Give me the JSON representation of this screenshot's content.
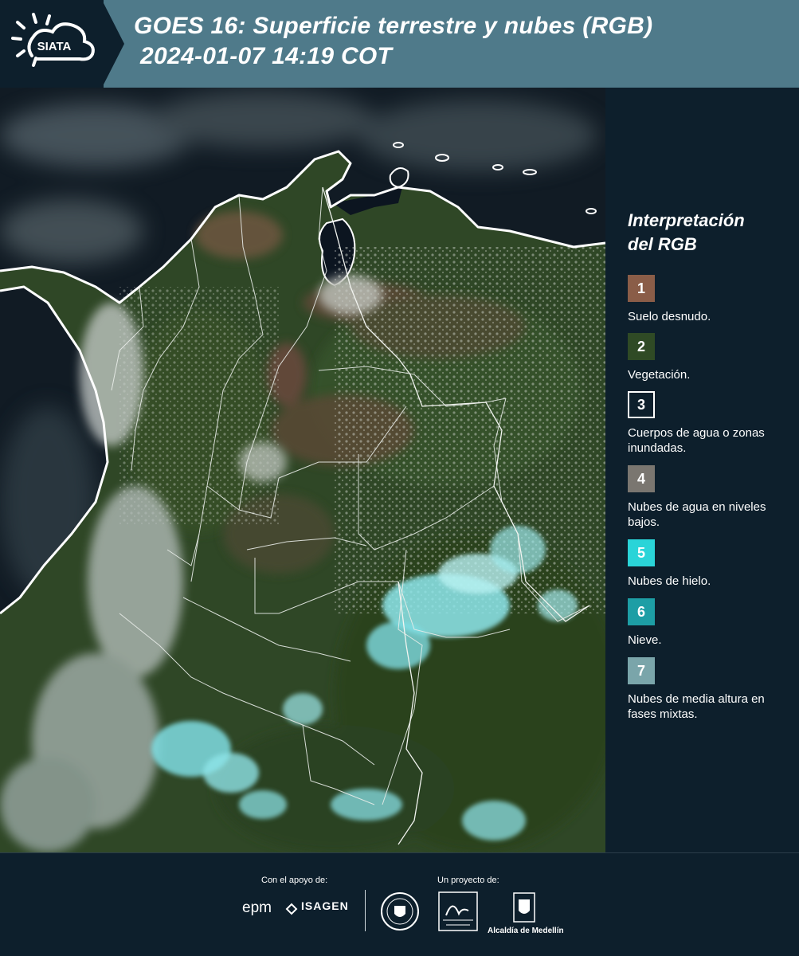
{
  "header": {
    "logo_text": "SIATA",
    "title_line1": "GOES 16: Superficie terrestre y nubes (RGB)",
    "title_line2": "2024-01-07 14:19 COT"
  },
  "legend": {
    "title_line1": "Interpretación",
    "title_line2": "del RGB",
    "items": [
      {
        "number": "1",
        "label": "Suelo desnudo.",
        "color": "#8a5d48"
      },
      {
        "number": "2",
        "label": "Vegetación.",
        "color": "#2f4a25"
      },
      {
        "number": "3",
        "label": "Cuerpos de agua o zonas inundadas.",
        "color": "#0d1f2c"
      },
      {
        "number": "4",
        "label": "Nubes de agua en niveles bajos.",
        "color": "#7a7670"
      },
      {
        "number": "5",
        "label": "Nubes de hielo.",
        "color": "#2ad4d8"
      },
      {
        "number": "6",
        "label": "Nieve.",
        "color": "#1d9ea5"
      },
      {
        "number": "7",
        "label": "Nubes de media altura en fases mixtas.",
        "color": "#7aa5aa"
      }
    ]
  },
  "footer": {
    "support_label": "Con el apoyo de:",
    "project_label": "Un proyecto de:",
    "epm": "epm",
    "isagen": "ISAGEN",
    "alcaldia": "Alcaldía de Medellín"
  },
  "colors": {
    "header_bg": "#4f7a8a",
    "panel_bg": "#0d1f2c"
  }
}
